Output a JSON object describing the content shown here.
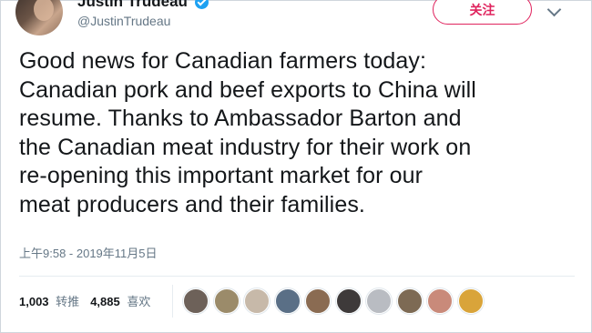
{
  "header": {
    "display_name": "Justin Trudeau",
    "handle": "@JustinTrudeau",
    "follow_label": "关注"
  },
  "tweet": {
    "lines": [
      "Good news for Canadian farmers today:",
      "Canadian pork and beef exports to China will",
      "resume. Thanks to Ambassador Barton and",
      "the Canadian meat industry for their work on",
      "re-opening this important market for our",
      "meat producers and their families."
    ],
    "timestamp": "上午9:58 - 2019年11月5日"
  },
  "stats": {
    "retweets_count": "1,003",
    "retweets_label": "转推",
    "likes_count": "4,885",
    "likes_label": "喜欢"
  },
  "likers": [
    {
      "icon": "liker-avatar-icon",
      "color": "#6d6159"
    },
    {
      "icon": "liker-avatar-icon",
      "color": "#9b8b6a"
    },
    {
      "icon": "liker-avatar-icon",
      "color": "#c7b9a9"
    },
    {
      "icon": "liker-avatar-icon",
      "color": "#5a6f86"
    },
    {
      "icon": "liker-avatar-icon",
      "color": "#8a6b52"
    },
    {
      "icon": "liker-avatar-icon",
      "color": "#3e3a3a"
    },
    {
      "icon": "liker-avatar-icon",
      "color": "#b9bcc2"
    },
    {
      "icon": "liker-avatar-icon",
      "color": "#7d6a54"
    },
    {
      "icon": "liker-avatar-icon",
      "color": "#c98a7a"
    },
    {
      "icon": "liker-avatar-icon",
      "color": "#d9a43a"
    }
  ],
  "colors": {
    "accent": "#e0245e",
    "verified": "#1da1f2",
    "muted_text": "#657786"
  }
}
